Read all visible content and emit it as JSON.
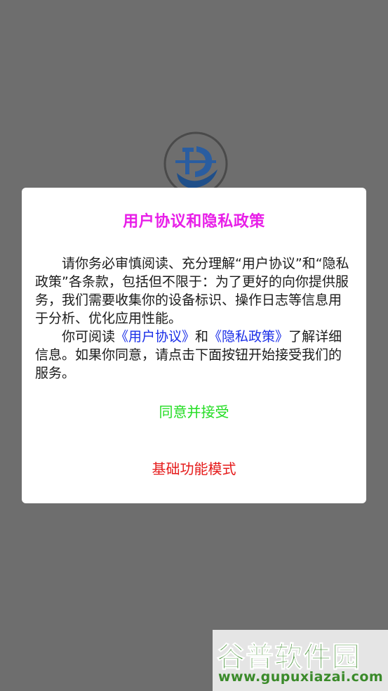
{
  "colors": {
    "overlay": "#6e6e6e",
    "title": "#e81fe8",
    "link": "#1a2ee8",
    "accept": "#22dd22",
    "basic": "#e51b1b",
    "watermark": "#3a8a2a"
  },
  "dialog": {
    "title": "用户协议和隐私政策",
    "para1": "请你务必审慎阅读、充分理解“用户协议”和“隐私政策”各条款，包括但不限于：为了更好的向你提供服务，我们需要收集你的设备标识、操作日志等信息用于分析、优化应用性能。",
    "para2_prefix": "你可阅读",
    "link_user_agreement": "《用户协议》",
    "para2_and": "和",
    "link_privacy_policy": "《隐私政策》",
    "para2_suffix": "了解详细信息。如果你同意，请点击下面按钮开始接受我们的服务。",
    "accept_button": "同意并接受",
    "basic_mode_button": "基础功能模式"
  },
  "background": {
    "logo_icon": "app-logo"
  },
  "watermark": {
    "title": "谷普软件园",
    "url": "www.gupuxiazai.com"
  }
}
